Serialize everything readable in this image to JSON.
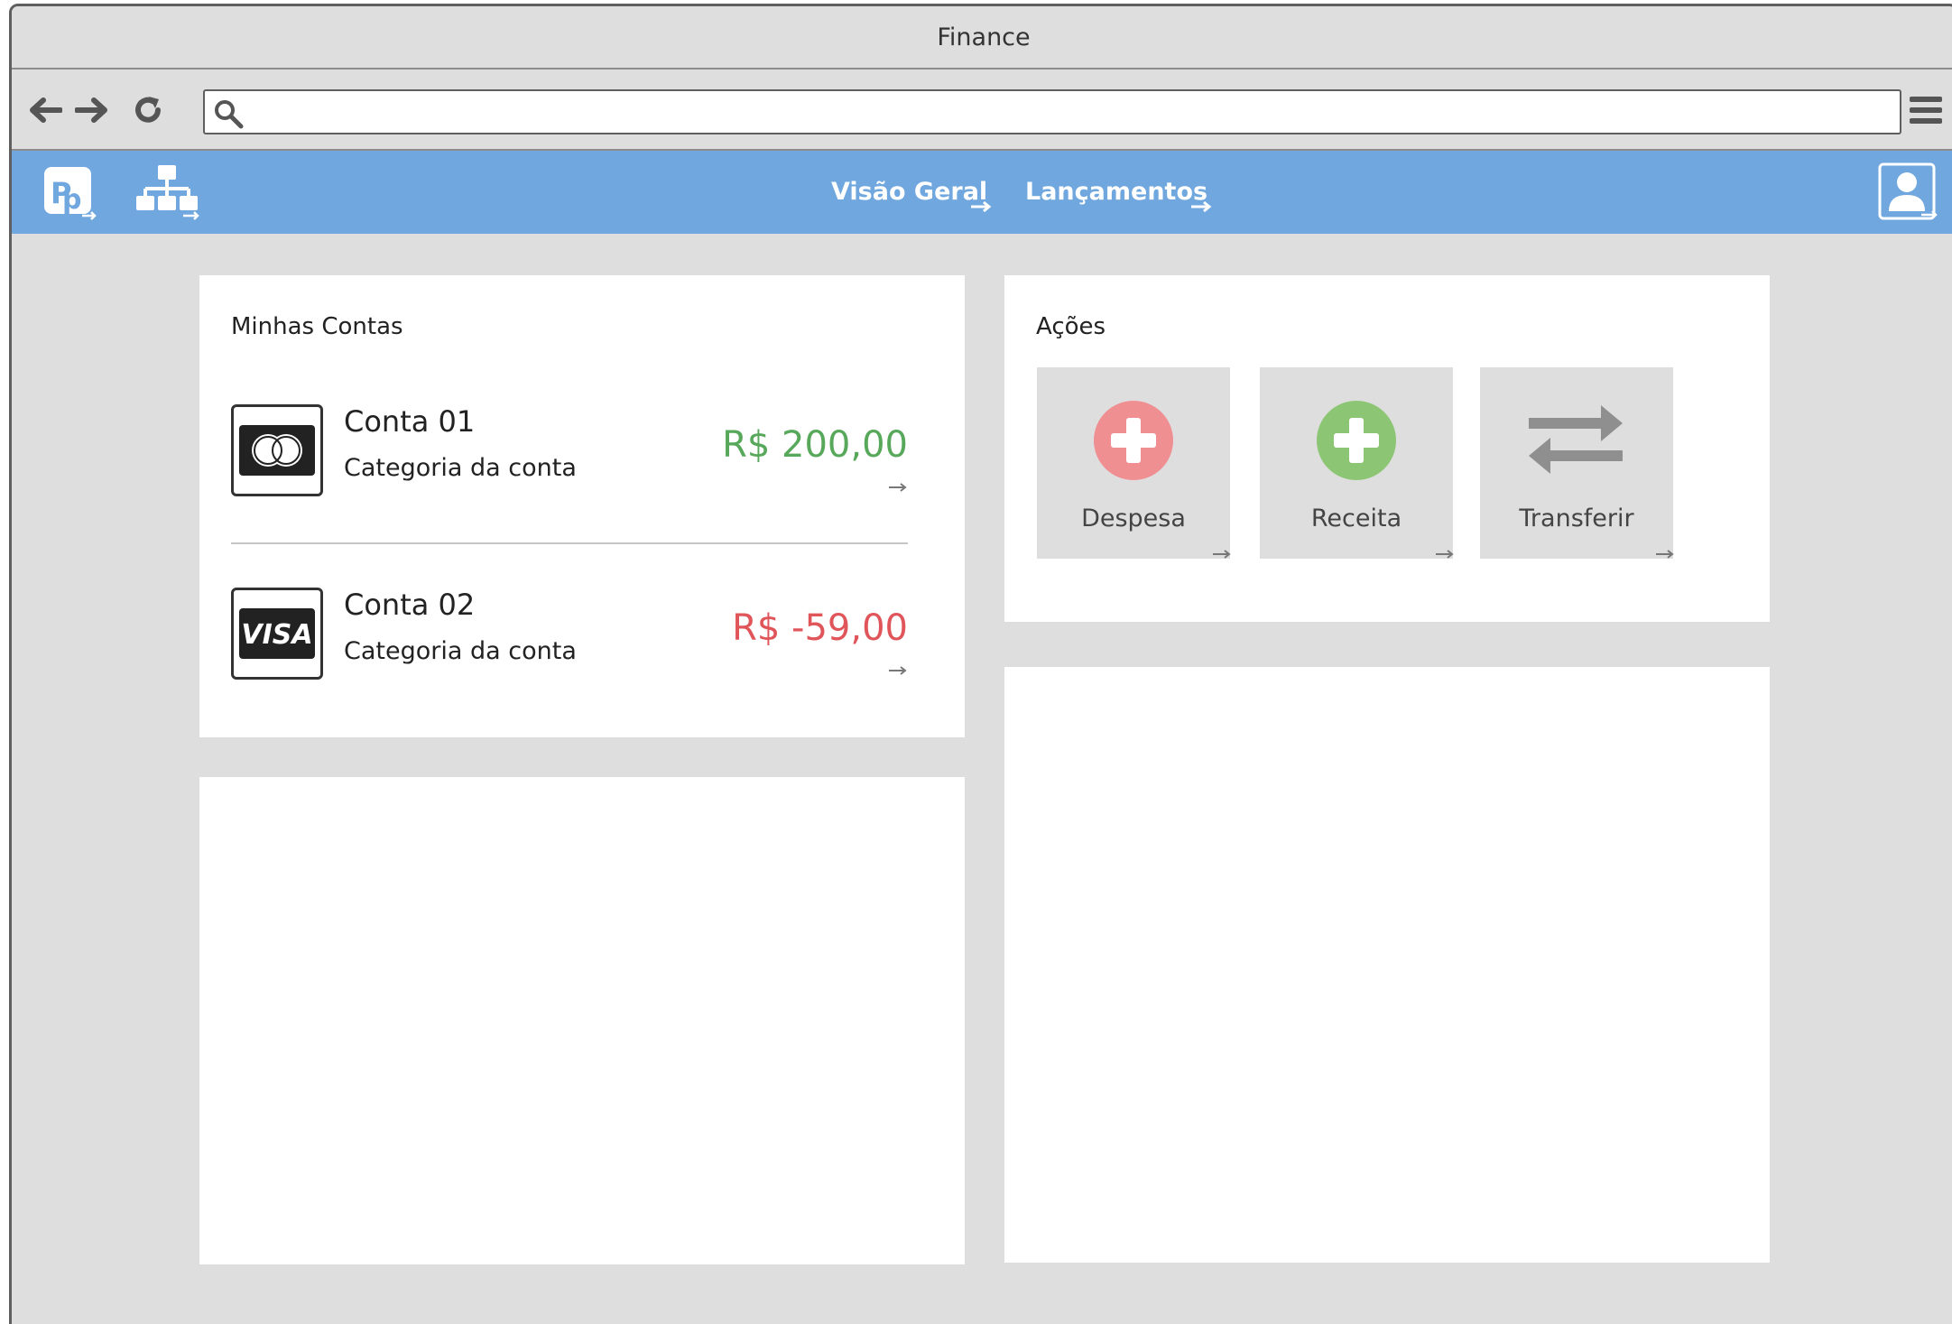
{
  "window": {
    "title": "Finance"
  },
  "browser": {
    "url_value": "",
    "url_placeholder": ""
  },
  "nav": {
    "links": [
      {
        "label": "Visão Geral"
      },
      {
        "label": "Lançamentos"
      }
    ]
  },
  "accounts_panel": {
    "title": "Minhas Contas",
    "accounts": [
      {
        "name": "Conta 01",
        "category": "Categoria da conta",
        "amount": "R$ 200,00",
        "card_icon": "mastercard-icon",
        "amount_color": "#57a85a"
      },
      {
        "name": "Conta 02",
        "category": "Categoria da conta",
        "amount": "R$ -59,00",
        "card_icon": "visa-icon",
        "amount_color": "#e0555a"
      }
    ]
  },
  "actions_panel": {
    "title": "Ações",
    "actions": [
      {
        "label": "Despesa",
        "icon": "plus-circle-red-icon",
        "color": "#ef8f92"
      },
      {
        "label": "Receita",
        "icon": "plus-circle-green-icon",
        "color": "#8cc674"
      },
      {
        "label": "Transferir",
        "icon": "swap-arrows-icon",
        "color": "#8f8f8f"
      }
    ]
  },
  "colors": {
    "appbar": "#6fa7de",
    "background": "#dedede",
    "panel": "#ffffff"
  }
}
